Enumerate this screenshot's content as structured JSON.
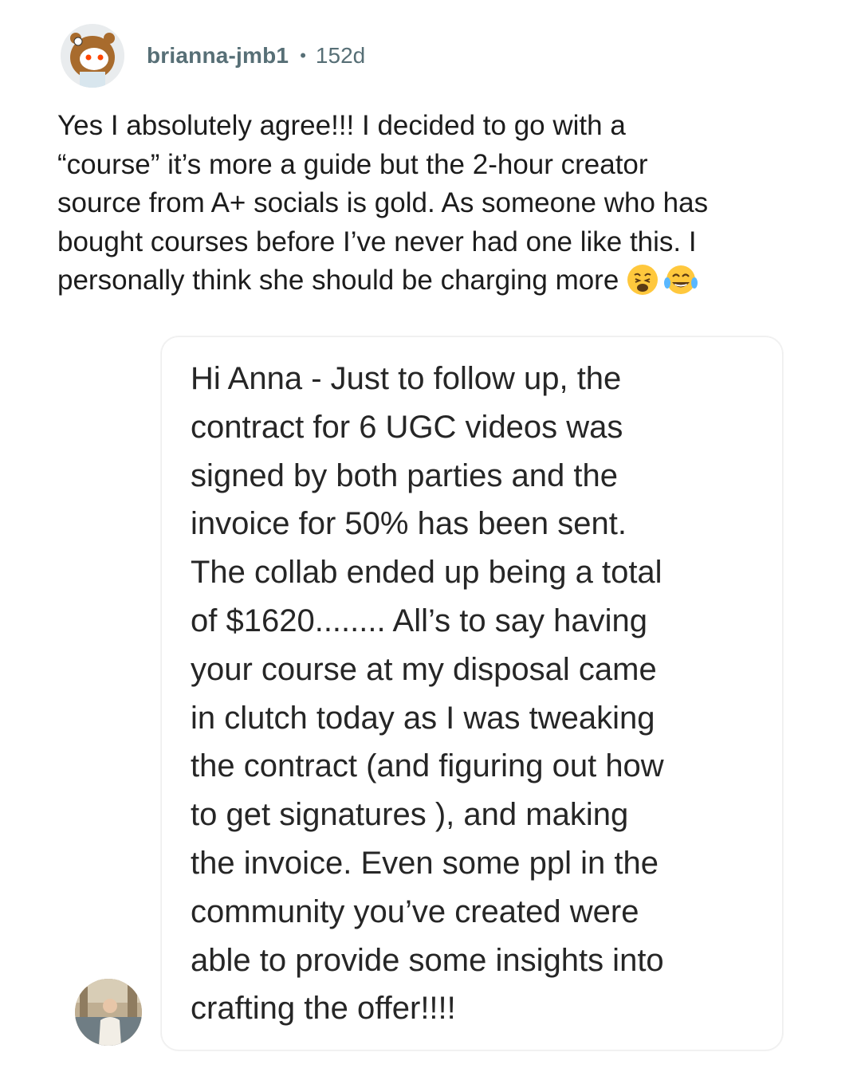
{
  "comment": {
    "username": "brianna-jmb1",
    "separator": "•",
    "age": "152d",
    "avatar_icon": "reddit-snoo-avatar-icon",
    "lines": [
      "Yes I absolutely agree!!! I decided to go with a",
      "“course” it’s more a guide but the 2-hour creator",
      "source from A+ socials is gold. As someone who has",
      "bought courses before I’ve never had one like this. I",
      "personally think she should be charging more"
    ],
    "emojis": [
      "weary-face-emoji",
      "tears-of-joy-emoji"
    ]
  },
  "message": {
    "sender_avatar_icon": "sender-photo-avatar",
    "lines": [
      "Hi Anna - Just to follow up, the",
      "contract for 6 UGC videos was",
      "signed by both parties and the",
      "invoice for 50% has been sent.",
      "The collab ended up being a total",
      "of $1620........ All’s to say having",
      "your course at my disposal came",
      "in clutch today as I was tweaking",
      "the contract (and figuring out how",
      "to get signatures ), and making",
      "the invoice. Even some ppl in the",
      "community you’ve created were",
      "able to provide some insights into",
      "crafting the offer!!!!"
    ]
  },
  "colors": {
    "meta_text": "#576f76",
    "body_text": "#1c1c1c",
    "dm_text": "#262626",
    "emoji_yellow": "#ffc83d"
  }
}
